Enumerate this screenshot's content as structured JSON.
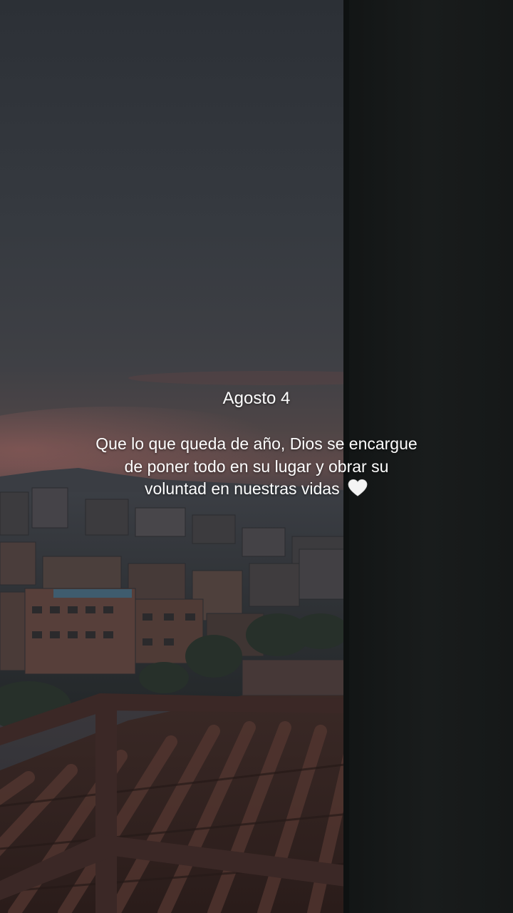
{
  "caption": {
    "date": "Agosto 4",
    "message": "Que lo que queda de año, Dios se encargue de poner todo en su lugar y obrar su voluntad en nuestras vidas"
  },
  "colors": {
    "sky_top": "#2f3339",
    "sky_horizon": "#5d4a4c",
    "sunset_glow": "#8a5a5a",
    "wall": "#141717",
    "roof_tile": "#4a2f2a",
    "railing": "#3a2624",
    "text": "#ffffff"
  },
  "icons": {
    "heart": "white-heart-icon"
  }
}
